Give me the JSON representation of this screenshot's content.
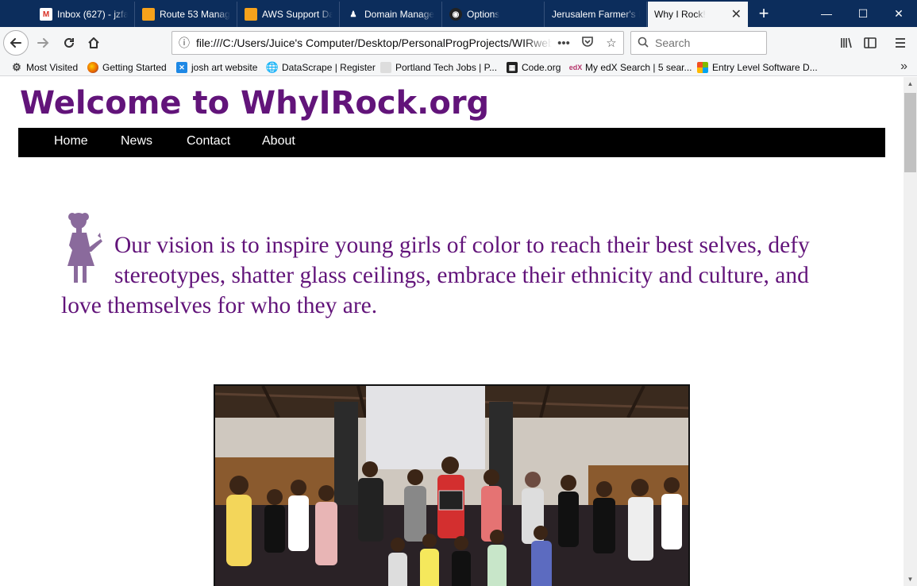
{
  "browser": {
    "tabs": [
      {
        "label": "Inbox (627) - jzfa",
        "icon": "gmail-icon",
        "active": false
      },
      {
        "label": "Route 53 Manag",
        "icon": "aws-box-icon",
        "active": false
      },
      {
        "label": "AWS Support Da",
        "icon": "aws-box-icon",
        "active": false
      },
      {
        "label": "Domain Manage",
        "icon": "godaddy-icon",
        "active": false
      },
      {
        "label": "Options",
        "icon": "github-icon",
        "active": false
      },
      {
        "label": "Jerusalem Farmer's P",
        "icon": "",
        "active": false
      },
      {
        "label": "Why I Rock!",
        "icon": "",
        "active": true
      }
    ],
    "new_tab_symbol": "+",
    "window_controls": {
      "minimize": "—",
      "maximize": "☐",
      "close": "✕"
    },
    "url": "file:///C:/Users/Juice's Computer/Desktop/PersonalProgProjects/WIRwebsite/index.html",
    "url_more": "•••",
    "search_placeholder": "Search",
    "bookmarks": [
      {
        "label": "Most Visited",
        "icon": "gear-icon"
      },
      {
        "label": "Getting Started",
        "icon": "firefox-icon"
      },
      {
        "label": "josh art website",
        "icon": "x-icon"
      },
      {
        "label": "DataScrape | Register",
        "icon": "globe-icon"
      },
      {
        "label": "Portland Tech Jobs | P...",
        "icon": "portland-icon"
      },
      {
        "label": "Code.org",
        "icon": "codeorg-icon"
      },
      {
        "label": "My edX Search | 5 sear...",
        "icon": "edx-icon"
      },
      {
        "label": "Entry Level Software D...",
        "icon": "microsoft-icon"
      }
    ],
    "bookmarks_overflow": "»"
  },
  "site": {
    "title": "Welcome to WhyIRock.org",
    "nav": [
      {
        "label": "Home"
      },
      {
        "label": "News"
      },
      {
        "label": "Contact"
      },
      {
        "label": "About"
      }
    ],
    "vision": "Our vision is to inspire young girls of color to reach their best selves, defy stereotypes, shatter glass ceilings, embrace their ethnicity and culture, and love themselves for who they are.",
    "colors": {
      "brand_purple": "#62147a",
      "nav_bg": "#000000",
      "tab_strip": "#0c2d5c"
    }
  }
}
